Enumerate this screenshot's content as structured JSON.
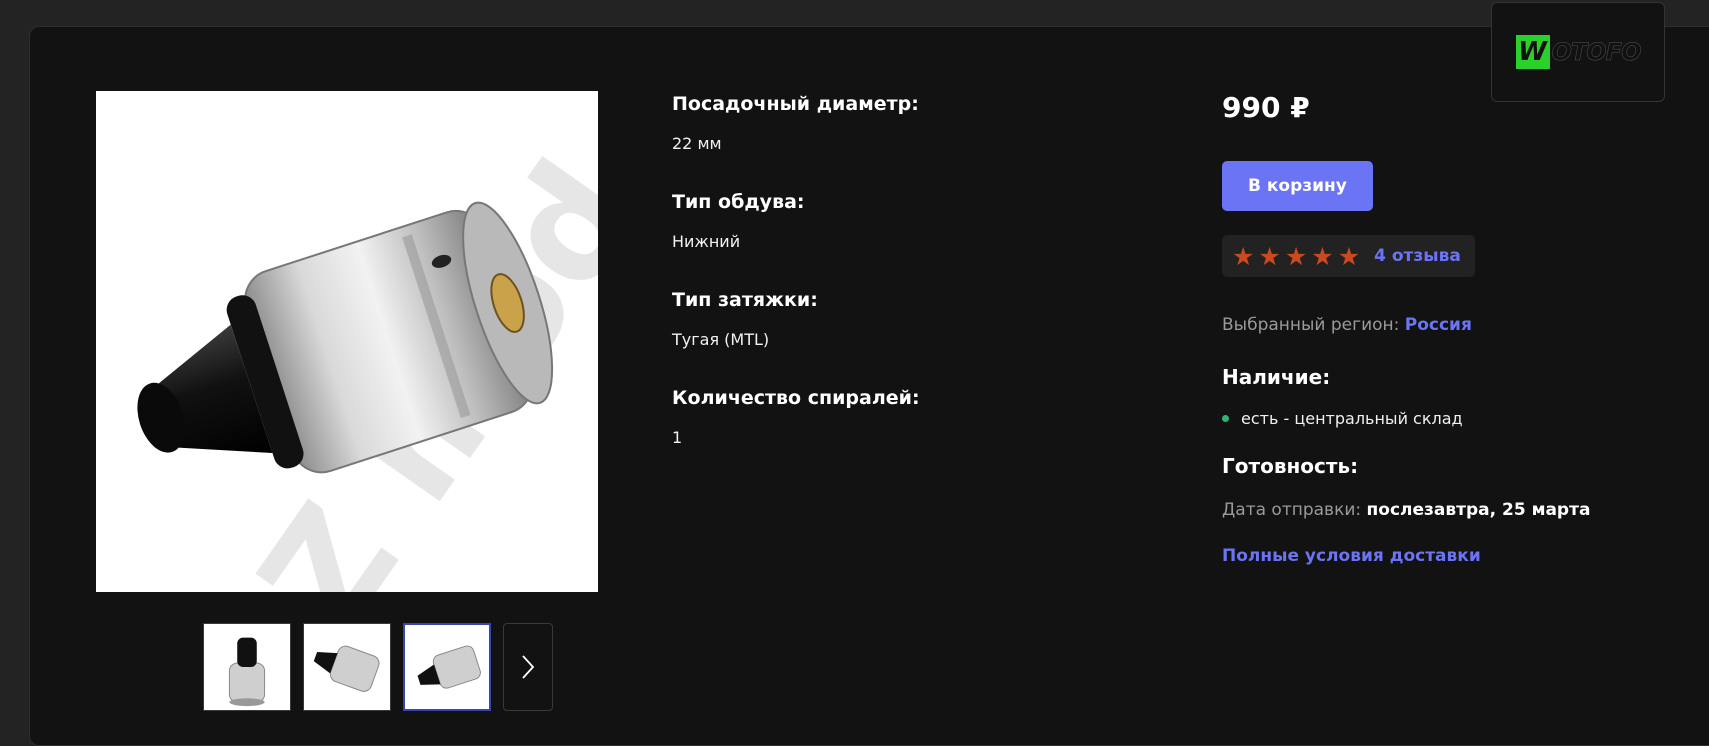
{
  "product": {
    "image_alt": "",
    "thumbnails": [
      {
        "index": 1,
        "active": false
      },
      {
        "index": 2,
        "active": false
      },
      {
        "index": 3,
        "active": true
      }
    ]
  },
  "specs": [
    {
      "label": "Посадочный диаметр:",
      "value": "22 мм"
    },
    {
      "label": "Тип обдува:",
      "value": "Нижний"
    },
    {
      "label": "Тип затяжки:",
      "value": "Тугая (MTL)"
    },
    {
      "label": "Количество спиралей:",
      "value": "1"
    }
  ],
  "purchase": {
    "price": "990 ₽",
    "cart_label": "В корзину",
    "rating": 5,
    "rating_max": 5,
    "reviews_label": "4 отзыва",
    "region_label": "Выбранный регион:",
    "region_value": "Россия",
    "availability_title": "Наличие:",
    "availability_item": "есть - центральный склад",
    "readiness_title": "Готовность:",
    "ship_label": "Дата отправки:",
    "ship_value": "послезавтра, 25 марта",
    "delivery_link": "Полные условия доставки"
  },
  "brand": {
    "name": "WOTOFO",
    "box_letter": "W",
    "wordmark": "OTOFO"
  },
  "colors": {
    "accent": "#6b74f5",
    "star": "#c84a1e",
    "stock_dot": "#2bb673",
    "background": "#121212",
    "page_background": "#232323"
  }
}
